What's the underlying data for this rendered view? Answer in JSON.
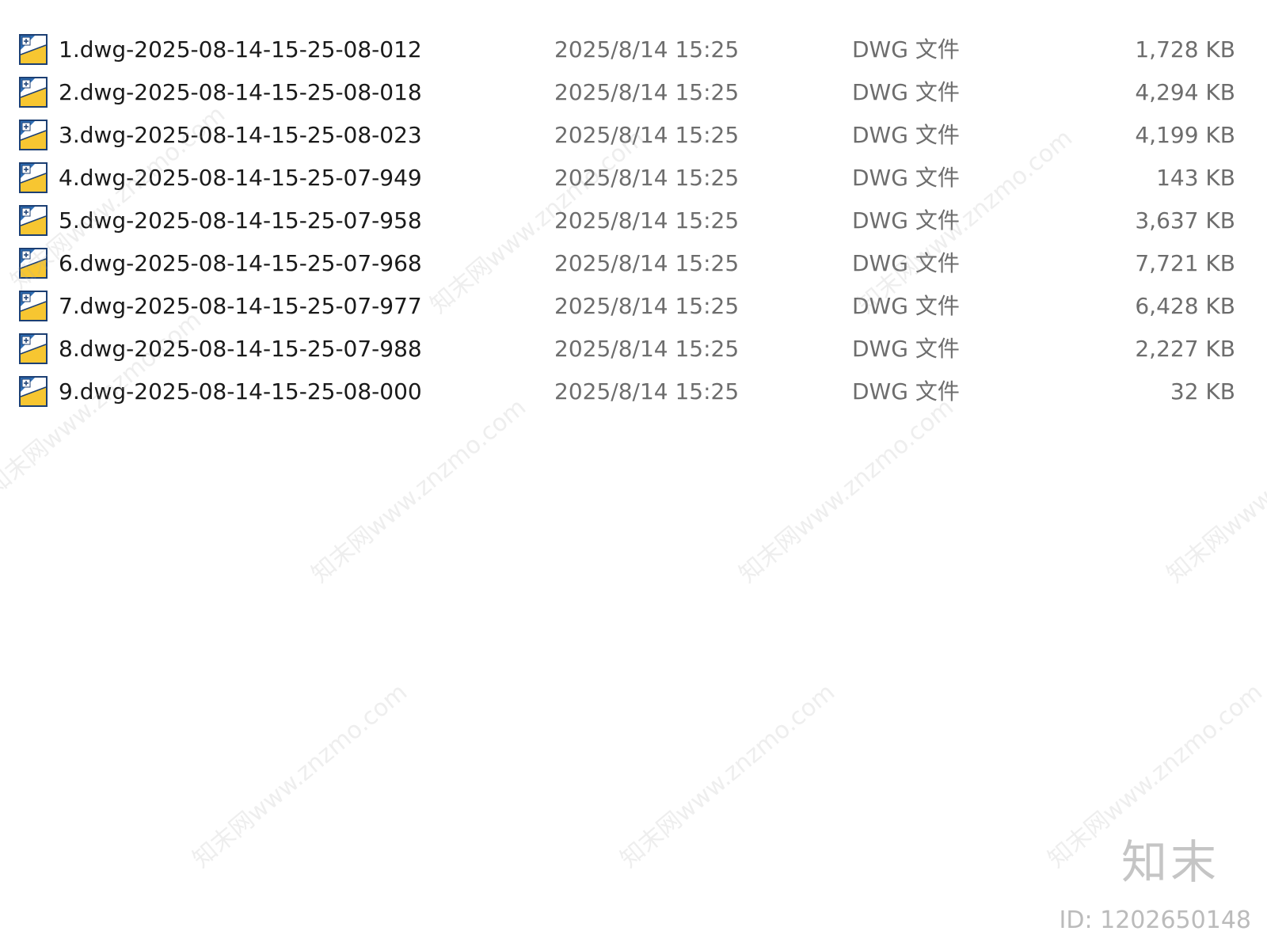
{
  "files": [
    {
      "name": "1.dwg-2025-08-14-15-25-08-012",
      "modified": "2025/8/14 15:25",
      "type": "DWG 文件",
      "size": "1,728 KB",
      "icon": "dwg-file-icon"
    },
    {
      "name": "2.dwg-2025-08-14-15-25-08-018",
      "modified": "2025/8/14 15:25",
      "type": "DWG 文件",
      "size": "4,294 KB",
      "icon": "dwg-file-icon"
    },
    {
      "name": "3.dwg-2025-08-14-15-25-08-023",
      "modified": "2025/8/14 15:25",
      "type": "DWG 文件",
      "size": "4,199 KB",
      "icon": "dwg-file-icon"
    },
    {
      "name": "4.dwg-2025-08-14-15-25-07-949",
      "modified": "2025/8/14 15:25",
      "type": "DWG 文件",
      "size": "143 KB",
      "icon": "dwg-file-icon"
    },
    {
      "name": "5.dwg-2025-08-14-15-25-07-958",
      "modified": "2025/8/14 15:25",
      "type": "DWG 文件",
      "size": "3,637 KB",
      "icon": "dwg-file-icon"
    },
    {
      "name": "6.dwg-2025-08-14-15-25-07-968",
      "modified": "2025/8/14 15:25",
      "type": "DWG 文件",
      "size": "7,721 KB",
      "icon": "dwg-file-icon"
    },
    {
      "name": "7.dwg-2025-08-14-15-25-07-977",
      "modified": "2025/8/14 15:25",
      "type": "DWG 文件",
      "size": "6,428 KB",
      "icon": "dwg-file-icon"
    },
    {
      "name": "8.dwg-2025-08-14-15-25-07-988",
      "modified": "2025/8/14 15:25",
      "type": "DWG 文件",
      "size": "2,227 KB",
      "icon": "dwg-file-icon"
    },
    {
      "name": "9.dwg-2025-08-14-15-25-08-000",
      "modified": "2025/8/14 15:25",
      "type": "DWG 文件",
      "size": "32 KB",
      "icon": "dwg-file-icon"
    }
  ],
  "watermark": {
    "text": "知末网www.znzmo.com",
    "logo": "知末",
    "id_label": "ID: 1202650148"
  },
  "colors": {
    "icon_yellow": "#f7c631",
    "icon_blue": "#2f6fb6",
    "secondary_text": "#6d6d6d"
  }
}
